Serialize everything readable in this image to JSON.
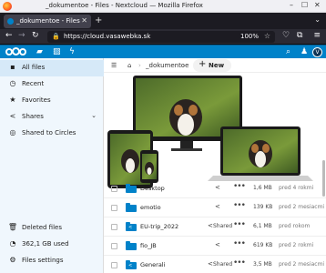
{
  "window": {
    "title": "_dokumentoe - Files - Nextcloud — Mozilla Firefox",
    "minimize": "–",
    "maximize": "☐",
    "close": "✕"
  },
  "tab": {
    "label": "_dokumentoe - Files - Ne",
    "close": "✕",
    "new_tab": "+",
    "list_all": "⌄"
  },
  "navbar": {
    "back": "←",
    "forward": "→",
    "reload": "↻",
    "url": "https://cloud.vasawebka.sk",
    "zoom": "100%",
    "menu": "≡"
  },
  "header": {
    "apps": [
      "folder-icon",
      "image-icon",
      "activity-icon"
    ],
    "right_icons": [
      "search-icon",
      "contacts-icon"
    ],
    "avatar_letter": "V"
  },
  "sidebar": {
    "items": [
      {
        "icon": "▪",
        "label": "All files",
        "active": true
      },
      {
        "icon": "◷",
        "label": "Recent"
      },
      {
        "icon": "★",
        "label": "Favorites"
      },
      {
        "icon": "<",
        "label": "Shares",
        "chevron": "⌄"
      },
      {
        "icon": "◎",
        "label": "Shared to Circles"
      }
    ],
    "bottom": [
      {
        "icon": "🗑",
        "label": "Deleted files"
      },
      {
        "icon": "◔",
        "label": "362,1 GB used"
      },
      {
        "icon": "⚙",
        "label": "Files settings"
      }
    ]
  },
  "breadcrumbs": {
    "toggle": "☰",
    "home": "⌂",
    "folder": "_dokumentoe",
    "new_label": "New",
    "plus": "+"
  },
  "files": [
    {
      "name": "Desktop",
      "shared": false,
      "size": "1,6 MB",
      "modified": "pred 4 rokmi"
    },
    {
      "name": "emotio",
      "shared": false,
      "size": "139 KB",
      "modified": "pred 2 mesiacmi"
    },
    {
      "name": "EU-trip_2022",
      "shared": true,
      "share_label": "Shared",
      "size": "6,1 MB",
      "modified": "pred rokom"
    },
    {
      "name": "fio_JB",
      "shared": false,
      "size": "619 KB",
      "modified": "pred 2 rokmi"
    },
    {
      "name": "Generali",
      "shared": true,
      "share_label": "Shared",
      "size": "3,5 MB",
      "modified": "pred 2 mesiacmi"
    }
  ],
  "colors": {
    "nextcloud_blue": "#0082c9",
    "sidebar_bg": "#f0f7fd",
    "firefox_chrome": "#2b2a33"
  }
}
